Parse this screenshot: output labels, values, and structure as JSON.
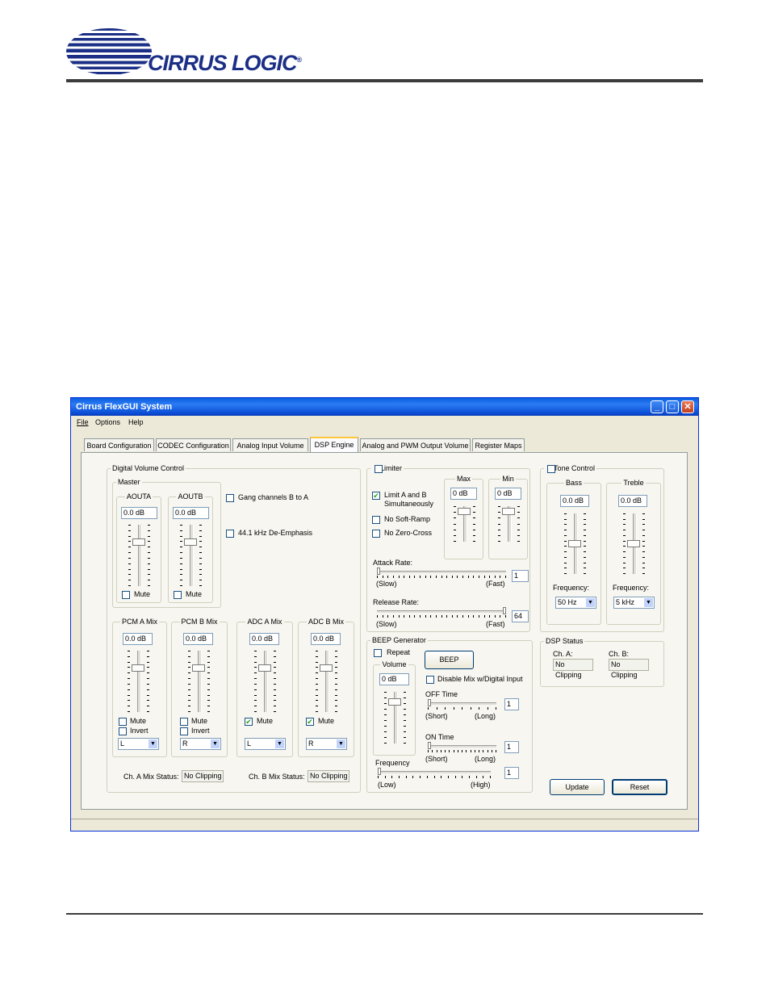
{
  "header": {
    "logo_text": "CIRRUS LOGIC",
    "logo_mark": "®"
  },
  "window": {
    "title": "Cirrus FlexGUI System",
    "menu": [
      "File",
      "Options",
      "Help"
    ],
    "tabs": [
      "Board Configuration",
      "CODEC Configuration",
      "Analog Input Volume",
      "DSP Engine",
      "Analog and PWM Output Volume",
      "Register Maps"
    ],
    "active_tab": "DSP Engine"
  },
  "dvc": {
    "title": "Digital Volume Control",
    "master_title": "Master",
    "aouta": {
      "title": "AOUTA",
      "value": "0.0 dB",
      "mute": "Mute",
      "level": 0.25
    },
    "aoutb": {
      "title": "AOUTB",
      "value": "0.0 dB",
      "mute": "Mute",
      "level": 0.25
    },
    "gang": "Gang channels B to A",
    "deemph": "44.1 kHz De-Emphasis",
    "mixes": [
      {
        "title": "PCM A Mix",
        "value": "0.0 dB",
        "mute": "Mute",
        "invert": "Invert",
        "select": "L",
        "mute_checked": false,
        "level": 0.25
      },
      {
        "title": "PCM B Mix",
        "value": "0.0 dB",
        "mute": "Mute",
        "invert": "Invert",
        "select": "R",
        "mute_checked": false,
        "level": 0.25
      },
      {
        "title": "ADC A Mix",
        "value": "0.0 dB",
        "mute": "Mute",
        "select": "L",
        "mute_checked": true,
        "level": 0.25
      },
      {
        "title": "ADC B Mix",
        "value": "0.0 dB",
        "mute": "Mute",
        "select": "R",
        "mute_checked": true,
        "level": 0.25
      }
    ],
    "cha_status_label": "Ch. A Mix Status:",
    "cha_status": "No Clipping",
    "chb_status_label": "Ch. B Mix Status:",
    "chb_status": "No Clipping"
  },
  "limiter": {
    "title": "Limiter",
    "limit_ab": "Limit A and B",
    "simultaneously": "Simultaneously",
    "no_soft_ramp": "No Soft-Ramp",
    "no_zero_cross": "No Zero-Cross",
    "max_title": "Max",
    "max_value": "0 dB",
    "min_title": "Min",
    "min_value": "0 dB",
    "attack_label": "Attack Rate:",
    "attack_value": "1",
    "release_label": "Release Rate:",
    "release_value": "64",
    "slow": "(Slow)",
    "fast": "(Fast)"
  },
  "beep": {
    "title": "BEEP Generator",
    "repeat": "Repeat",
    "beep_button": "BEEP",
    "volume_title": "Volume",
    "volume_value": "0 dB",
    "disable_mix": "Disable Mix w/Digital Input",
    "off_time": "OFF Time",
    "off_value": "1",
    "on_time": "ON Time",
    "on_value": "1",
    "short": "(Short)",
    "long": "(Long)",
    "frequency": "Frequency",
    "freq_value": "1",
    "low": "(Low)",
    "high": "(High)"
  },
  "tone": {
    "title": "Tone Control",
    "bass_title": "Bass",
    "bass_value": "0.0 dB",
    "bass_freq_label": "Frequency:",
    "bass_freq": "50 Hz",
    "treble_title": "Treble",
    "treble_value": "0.0 dB",
    "treble_freq_label": "Frequency:",
    "treble_freq": "5 kHz"
  },
  "dsp_status": {
    "title": "DSP Status",
    "cha_label": "Ch. A:",
    "cha_value": "No Clipping",
    "chb_label": "Ch. B:",
    "chb_value": "No Clipping"
  },
  "buttons": {
    "update": "Update",
    "reset": "Reset"
  }
}
